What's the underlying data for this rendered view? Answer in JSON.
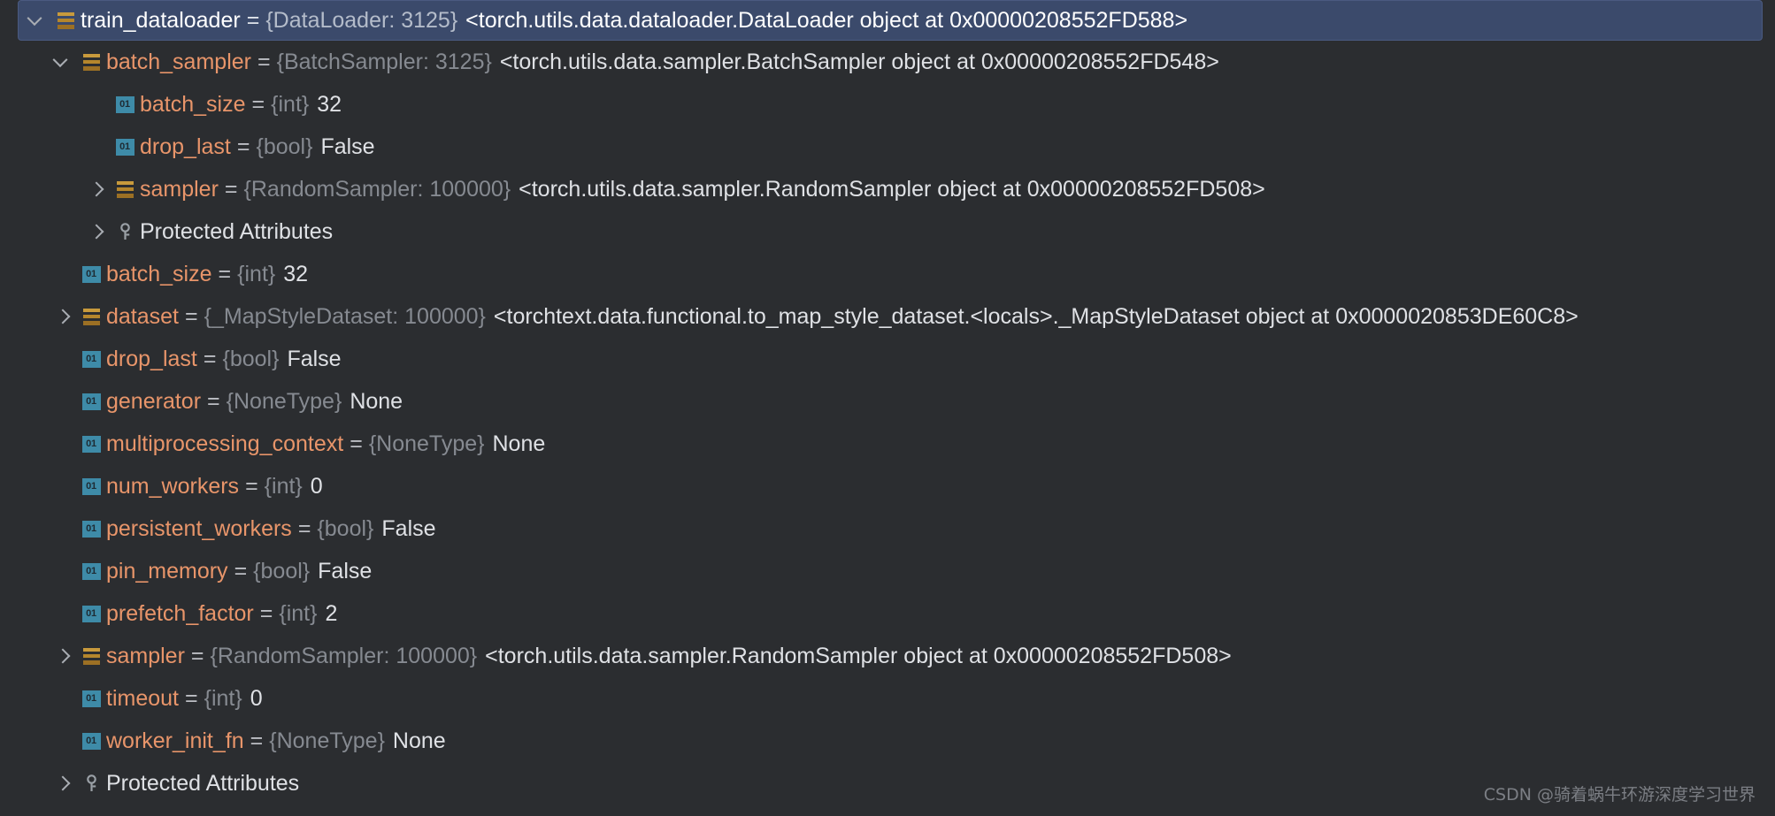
{
  "theme": {
    "background": "#2b2d30",
    "selected_row_background": "#3b4a6b",
    "name_color": "#e8956a",
    "type_color": "#868a91",
    "value_color": "#dfe1e5",
    "object_icon_color": "#c89a3c",
    "primitive_icon_color": "#3e8ba8"
  },
  "tree": {
    "rows": [
      {
        "indent": 0,
        "twisty": "expanded",
        "icon": "object-icon",
        "icon_label": "object",
        "selected": true,
        "name": "train_dataloader",
        "eq": "=",
        "type": "{DataLoader: 3125}",
        "repr": "<torch.utils.data.dataloader.DataLoader object at 0x00000208552FD588>",
        "value": ""
      },
      {
        "indent": 1,
        "twisty": "expanded",
        "icon": "object-icon",
        "icon_label": "object",
        "selected": false,
        "name": "batch_sampler",
        "eq": "=",
        "type": "{BatchSampler: 3125}",
        "repr": "<torch.utils.data.sampler.BatchSampler object at 0x00000208552FD548>",
        "value": ""
      },
      {
        "indent": 2,
        "twisty": "none",
        "icon": "primitive-icon",
        "icon_label": "01",
        "selected": false,
        "name": "batch_size",
        "eq": "=",
        "type": "{int}",
        "repr": "",
        "value": "32"
      },
      {
        "indent": 2,
        "twisty": "none",
        "icon": "primitive-icon",
        "icon_label": "01",
        "selected": false,
        "name": "drop_last",
        "eq": "=",
        "type": "{bool}",
        "repr": "",
        "value": "False"
      },
      {
        "indent": 2,
        "twisty": "collapsed",
        "icon": "object-icon",
        "icon_label": "object",
        "selected": false,
        "name": "sampler",
        "eq": "=",
        "type": "{RandomSampler: 100000}",
        "repr": "<torch.utils.data.sampler.RandomSampler object at 0x00000208552FD508>",
        "value": ""
      },
      {
        "indent": 2,
        "twisty": "collapsed",
        "icon": "key-icon",
        "icon_label": "key",
        "selected": false,
        "group_label": "Protected Attributes"
      },
      {
        "indent": 1,
        "twisty": "none",
        "icon": "primitive-icon",
        "icon_label": "01",
        "selected": false,
        "name": "batch_size",
        "eq": "=",
        "type": "{int}",
        "repr": "",
        "value": "32"
      },
      {
        "indent": 1,
        "twisty": "collapsed",
        "icon": "object-icon",
        "icon_label": "object",
        "selected": false,
        "name": "dataset",
        "eq": "=",
        "type": "{_MapStyleDataset: 100000}",
        "repr": "<torchtext.data.functional.to_map_style_dataset.<locals>._MapStyleDataset object at 0x0000020853DE60C8>",
        "value": ""
      },
      {
        "indent": 1,
        "twisty": "none",
        "icon": "primitive-icon",
        "icon_label": "01",
        "selected": false,
        "name": "drop_last",
        "eq": "=",
        "type": "{bool}",
        "repr": "",
        "value": "False"
      },
      {
        "indent": 1,
        "twisty": "none",
        "icon": "primitive-icon",
        "icon_label": "01",
        "selected": false,
        "name": "generator",
        "eq": "=",
        "type": "{NoneType}",
        "repr": "",
        "value": "None"
      },
      {
        "indent": 1,
        "twisty": "none",
        "icon": "primitive-icon",
        "icon_label": "01",
        "selected": false,
        "name": "multiprocessing_context",
        "eq": "=",
        "type": "{NoneType}",
        "repr": "",
        "value": "None"
      },
      {
        "indent": 1,
        "twisty": "none",
        "icon": "primitive-icon",
        "icon_label": "01",
        "selected": false,
        "name": "num_workers",
        "eq": "=",
        "type": "{int}",
        "repr": "",
        "value": "0"
      },
      {
        "indent": 1,
        "twisty": "none",
        "icon": "primitive-icon",
        "icon_label": "01",
        "selected": false,
        "name": "persistent_workers",
        "eq": "=",
        "type": "{bool}",
        "repr": "",
        "value": "False"
      },
      {
        "indent": 1,
        "twisty": "none",
        "icon": "primitive-icon",
        "icon_label": "01",
        "selected": false,
        "name": "pin_memory",
        "eq": "=",
        "type": "{bool}",
        "repr": "",
        "value": "False"
      },
      {
        "indent": 1,
        "twisty": "none",
        "icon": "primitive-icon",
        "icon_label": "01",
        "selected": false,
        "name": "prefetch_factor",
        "eq": "=",
        "type": "{int}",
        "repr": "",
        "value": "2"
      },
      {
        "indent": 1,
        "twisty": "collapsed",
        "icon": "object-icon",
        "icon_label": "object",
        "selected": false,
        "name": "sampler",
        "eq": "=",
        "type": "{RandomSampler: 100000}",
        "repr": "<torch.utils.data.sampler.RandomSampler object at 0x00000208552FD508>",
        "value": ""
      },
      {
        "indent": 1,
        "twisty": "none",
        "icon": "primitive-icon",
        "icon_label": "01",
        "selected": false,
        "name": "timeout",
        "eq": "=",
        "type": "{int}",
        "repr": "",
        "value": "0"
      },
      {
        "indent": 1,
        "twisty": "none",
        "icon": "primitive-icon",
        "icon_label": "01",
        "selected": false,
        "name": "worker_init_fn",
        "eq": "=",
        "type": "{NoneType}",
        "repr": "",
        "value": "None"
      },
      {
        "indent": 1,
        "twisty": "collapsed",
        "icon": "key-icon",
        "icon_label": "key",
        "selected": false,
        "group_label": "Protected Attributes"
      }
    ]
  },
  "watermark": {
    "text": "CSDN @骑着蜗牛环游深度学习世界"
  }
}
